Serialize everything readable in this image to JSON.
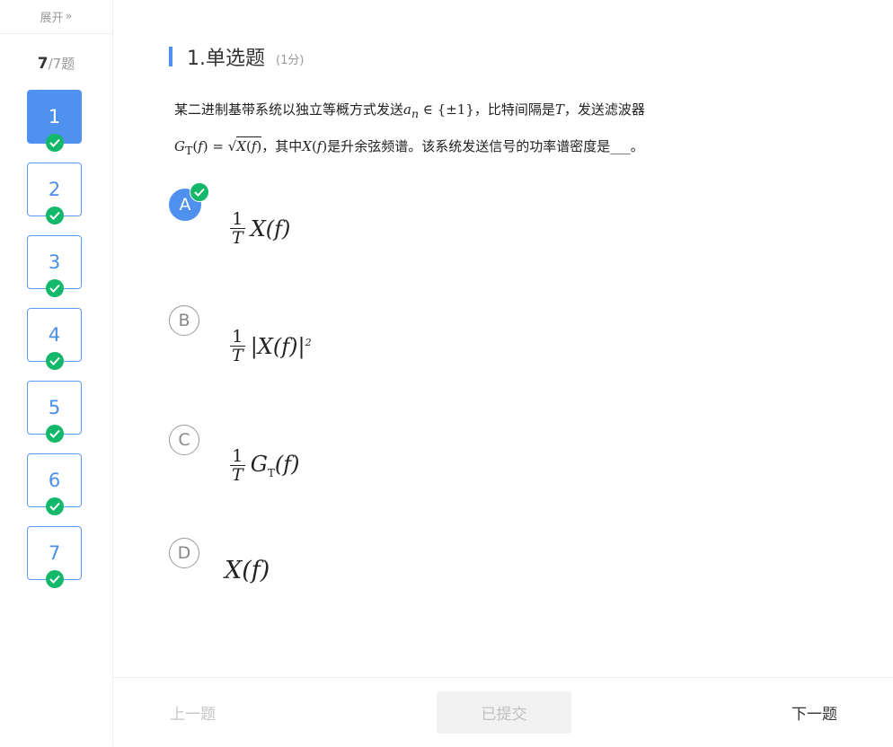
{
  "sidebar": {
    "expand_label": "展开",
    "expand_icon": "»",
    "progress_current": "7",
    "progress_total": "/7题",
    "questions": [
      {
        "label": "1",
        "active": true,
        "answered": true
      },
      {
        "label": "2",
        "active": false,
        "answered": true
      },
      {
        "label": "3",
        "active": false,
        "answered": true
      },
      {
        "label": "4",
        "active": false,
        "answered": true
      },
      {
        "label": "5",
        "active": false,
        "answered": true
      },
      {
        "label": "6",
        "active": false,
        "answered": true
      },
      {
        "label": "7",
        "active": false,
        "answered": true
      }
    ]
  },
  "question": {
    "title": "1.单选题",
    "score": "(1分)",
    "stem_line1_a": "某二进制基带系统以独立等概方式发送",
    "stem_line1_b": "，比特间隔是",
    "stem_line1_c": "，发送滤波器",
    "stem_line2_a": "，其中",
    "stem_line2_b": "是升余弦频谱。该系统发送信号的功率谱密度是___。",
    "options": [
      {
        "letter": "A",
        "selected": true,
        "formula": "1/T X(f)"
      },
      {
        "letter": "B",
        "selected": false,
        "formula": "1/T |X(f)|^2"
      },
      {
        "letter": "C",
        "selected": false,
        "formula": "1/T G_T(f)"
      },
      {
        "letter": "D",
        "selected": false,
        "formula": "X(f)"
      }
    ]
  },
  "footer": {
    "prev_label": "上一题",
    "submit_label": "已提交",
    "next_label": "下一题"
  },
  "colors": {
    "accent": "#4f91ee",
    "check": "#14b86a"
  }
}
